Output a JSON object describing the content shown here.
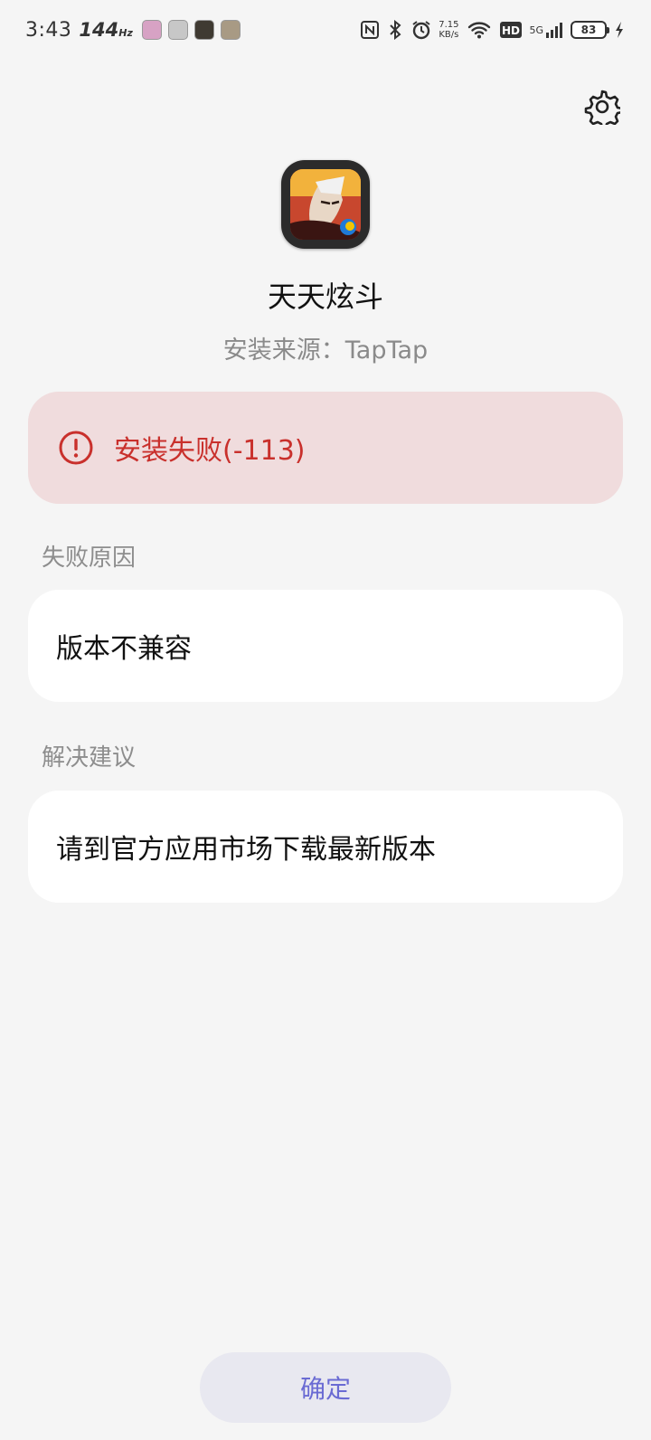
{
  "status_bar": {
    "time": "3:43",
    "refresh_rate": "144",
    "refresh_unit": "Hz",
    "net_speed_value": "7.15",
    "net_speed_unit": "KB/s",
    "network_type": "5G",
    "hd_label": "HD",
    "battery_level": "83"
  },
  "app": {
    "name": "天天炫斗",
    "source": "安装来源：TapTap"
  },
  "error": {
    "message": "安装失败(-113)",
    "color": "#c9302c",
    "background": "#f0dcdd"
  },
  "failure_reason": {
    "label": "失败原因",
    "value": "版本不兼容"
  },
  "suggestion": {
    "label": "解决建议",
    "value": "请到官方应用市场下载最新版本"
  },
  "confirm_button": {
    "label": "确定",
    "color": "#6a6bd3"
  },
  "icons": {
    "settings": "gear-icon",
    "error": "exclamation-circle-icon"
  }
}
